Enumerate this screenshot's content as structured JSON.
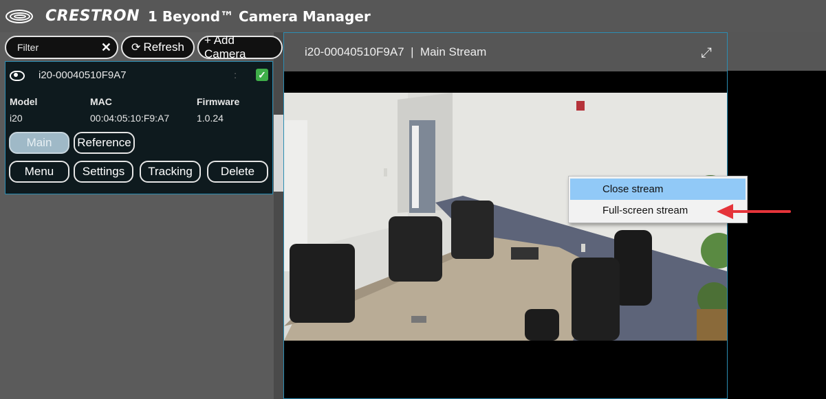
{
  "header": {
    "brand": "CRESTRON",
    "title": "1 Beyond™ Camera Manager"
  },
  "toolbar": {
    "filter_placeholder": "Filter",
    "clear_icon": "close-x",
    "refresh_label": "Refresh",
    "refresh_icon": "refresh-arrows",
    "add_camera_label": "+ Add Camera"
  },
  "camera": {
    "name": "i20-00040510F9A7",
    "dots": ":",
    "columns": [
      "Model",
      "MAC",
      "Firmware"
    ],
    "model": "i20",
    "mac": "00:04:05:10:F9:A7",
    "firmware": "1.0.24",
    "stream_buttons": [
      "Main",
      "Reference"
    ],
    "actions": [
      "Menu",
      "Settings",
      "Tracking",
      "Delete"
    ]
  },
  "stream": {
    "title": "i20-00040510F9A7  |  Main Stream",
    "expand_icon": "expand-diagonal"
  },
  "context_menu": {
    "items": [
      "Close stream",
      "Full-screen stream"
    ],
    "highlighted": "Close stream"
  },
  "colors": {
    "accent_border": "#2b8db3",
    "check_green": "#3fae49",
    "menu_highlight": "#91c9f7",
    "annotation_arrow": "#e5343a"
  }
}
